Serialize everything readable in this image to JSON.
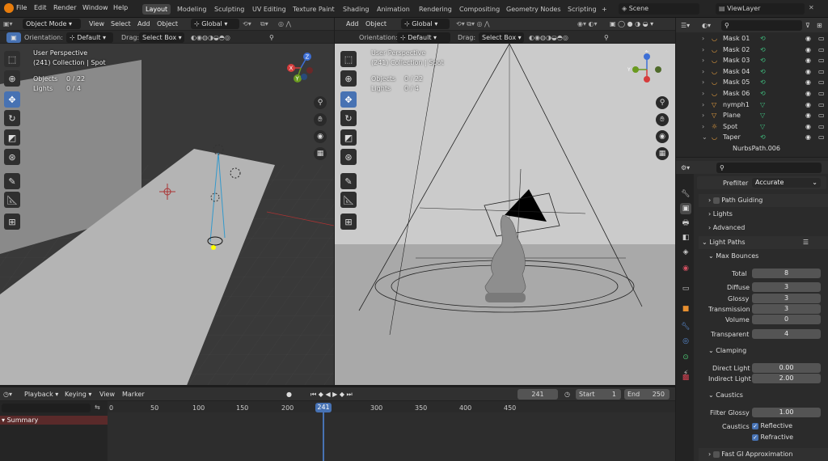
{
  "menus": [
    "File",
    "Edit",
    "Render",
    "Window",
    "Help"
  ],
  "workspaces": [
    "Layout",
    "Modeling",
    "Sculpting",
    "UV Editing",
    "Texture Paint",
    "Shading",
    "Animation",
    "Rendering",
    "Compositing",
    "Geometry Nodes",
    "Scripting"
  ],
  "add_ws": "+",
  "scene": "Scene",
  "view_layer": "ViewLayer",
  "left_header": {
    "mode": "Object Mode",
    "view": "View",
    "select": "Select",
    "add": "Add",
    "object": "Object",
    "transform": "Global"
  },
  "left_subheader": {
    "orientation_label": "Orientation:",
    "orientation": "Default",
    "drag_label": "Drag:",
    "drag": "Select Box"
  },
  "right_header": {
    "add": "Add",
    "object": "Object",
    "transform": "Global"
  },
  "right_subheader": {
    "orientation_label": "Orientation:",
    "orientation": "Default",
    "drag_label": "Drag:",
    "drag": "Select Box"
  },
  "left_overlay": {
    "perspective": "User Perspective",
    "collection": "(241) Collection | Spot",
    "objects_label": "Objects",
    "objects_val": "0 / 22",
    "lights_label": "Lights",
    "lights_val": "0 / 4"
  },
  "right_overlay": {
    "perspective": "User Perspective",
    "collection": "(241) Collection | Spot",
    "objects_label": "Objects",
    "objects_val": "0 / 22",
    "lights_label": "Lights",
    "lights_val": "0 / 4"
  },
  "gizmo": {
    "x": "X",
    "y": "Y",
    "z": "Z"
  },
  "outliner": [
    {
      "name": "Mask 01",
      "type": "curve"
    },
    {
      "name": "Mask 02",
      "type": "curve"
    },
    {
      "name": "Mask 03",
      "type": "curve"
    },
    {
      "name": "Mask 04",
      "type": "curve"
    },
    {
      "name": "Mask 05",
      "type": "curve"
    },
    {
      "name": "Mask 06",
      "type": "curve"
    },
    {
      "name": "nymph1",
      "type": "mesh"
    },
    {
      "name": "Plane",
      "type": "mesh"
    },
    {
      "name": "Spot",
      "type": "light"
    },
    {
      "name": "Taper",
      "type": "curve"
    },
    {
      "name": "NurbsPath.006",
      "type": "data"
    }
  ],
  "props": {
    "prefilter_label": "Prefilter",
    "prefilter": "Accurate",
    "path_guiding": "Path Guiding",
    "lights": "Lights",
    "advanced": "Advanced",
    "light_paths": "Light Paths",
    "max_bounces": "Max Bounces",
    "total_label": "Total",
    "total": "8",
    "diffuse_label": "Diffuse",
    "diffuse": "3",
    "glossy_label": "Glossy",
    "glossy": "3",
    "transmission_label": "Transmission",
    "transmission": "3",
    "volume_label": "Volume",
    "volume": "0",
    "transparent_label": "Transparent",
    "transparent": "4",
    "clamping": "Clamping",
    "direct_label": "Direct Light",
    "direct": "0.00",
    "indirect_label": "Indirect Light",
    "indirect": "2.00",
    "caustics": "Caustics",
    "filter_glossy_label": "Filter Glossy",
    "filter_glossy": "1.00",
    "caustics_label": "Caustics",
    "reflective": "Reflective",
    "refractive": "Refractive",
    "fast_gi": "Fast GI Approximation"
  },
  "timeline": {
    "playback": "Playback",
    "keying": "Keying",
    "view": "View",
    "marker": "Marker",
    "current_frame": "241",
    "start_label": "Start",
    "start": "1",
    "end_label": "End",
    "end": "250",
    "summary": "Summary",
    "ticks": [
      "0",
      "50",
      "100",
      "150",
      "200",
      "241",
      "300",
      "350",
      "400",
      "450"
    ]
  }
}
